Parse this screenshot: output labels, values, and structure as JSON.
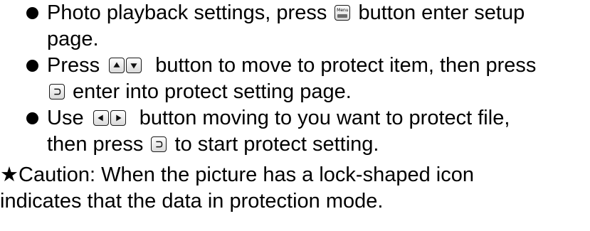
{
  "bullets": [
    {
      "lines": [
        {
          "before": "Photo playback settings, press ",
          "after": " button enter setup"
        },
        {
          "text": "page."
        }
      ],
      "key_label": "Menu"
    },
    {
      "lines": [
        {
          "before": "Press ",
          "after": " button to move to protect item, then press"
        },
        {
          "after": " enter into protect setting page."
        }
      ]
    },
    {
      "lines": [
        {
          "before": "Use ",
          "after": " button moving to you want to protect file,"
        },
        {
          "before": "then press ",
          "after": " to start protect setting."
        }
      ]
    }
  ],
  "caution": {
    "star": "★",
    "line1": "Caution: When the picture has a lock-shaped icon",
    "line2": "indicates that the data in protection mode."
  },
  "icons": {
    "bullet": "filled-circle",
    "menu_key": "menu-button-icon",
    "up_key": "up-arrow-button-icon",
    "down_key": "down-arrow-button-icon",
    "left_key": "left-arrow-button-icon",
    "right_key": "right-arrow-button-icon",
    "enter_key": "enter-button-icon"
  }
}
